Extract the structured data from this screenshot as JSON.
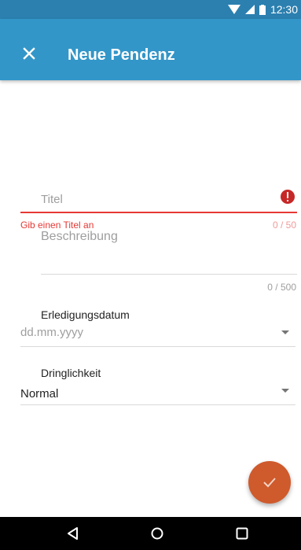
{
  "status_bar": {
    "time": "12:30"
  },
  "app_bar": {
    "title": "Neue Pendenz"
  },
  "form": {
    "title_field": {
      "placeholder": "Titel",
      "error": "Gib einen Titel an",
      "counter": "0 / 50"
    },
    "description_field": {
      "placeholder": "Beschreibung",
      "counter": "0 / 500"
    },
    "due_date": {
      "label": "Erledigungsdatum",
      "placeholder": "dd.mm.yyyy"
    },
    "urgency": {
      "label": "Dringlichkeit",
      "value": "Normal"
    }
  },
  "colors": {
    "app_bar": "#3396c8",
    "status_bar": "#2b80b0",
    "error": "#e53935",
    "fab": "#cf5a2c"
  },
  "icons": [
    "close-icon",
    "error-icon",
    "check-icon",
    "back-icon",
    "home-icon",
    "recents-icon",
    "wifi-icon",
    "signal-icon",
    "battery-icon"
  ]
}
